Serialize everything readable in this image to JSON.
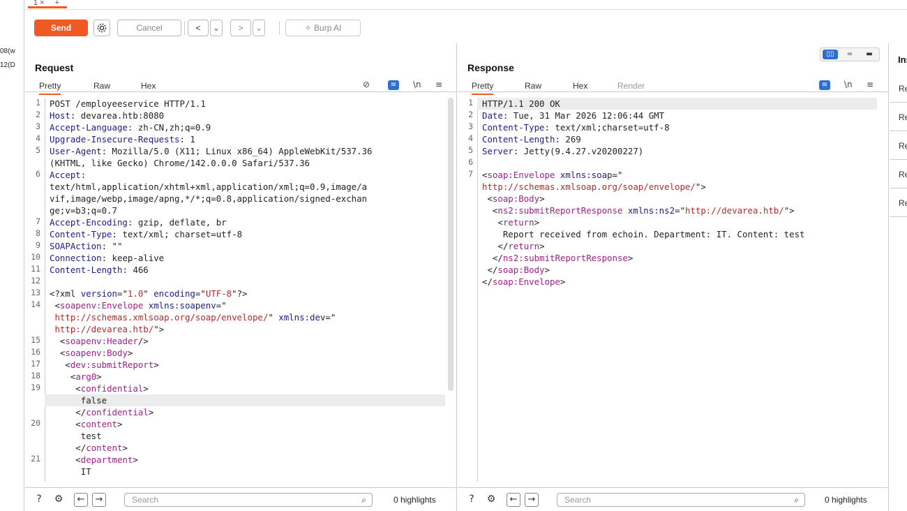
{
  "left_gutter": {
    "lines": [
      "08(w",
      "12(D"
    ]
  },
  "top_tab": {
    "label": "1 ×",
    "extra": "+"
  },
  "toolbar": {
    "send_label": "Send",
    "settings_icon": "gear-icon",
    "cancel_label": "Cancel",
    "back_label": "<",
    "back_menu_label": "⌄",
    "forward_label": ">",
    "forward_menu_label": "⌄",
    "burp_ai_label": "✧ Burp AI"
  },
  "request": {
    "title": "Request",
    "tabs": [
      "Pretty",
      "Raw",
      "Hex"
    ],
    "icons": {
      "hide": "⊘",
      "wrap": "≡",
      "newline": "\\n",
      "menu": "≡"
    },
    "lines": [
      {
        "n": "1",
        "html": "POST /employeeservice HTTP/1.1"
      },
      {
        "n": "2",
        "html": "<span class=\"k\">Host</span>: devarea.htb:8080"
      },
      {
        "n": "3",
        "html": "<span class=\"k\">Accept-Language</span>: zh-CN,zh;q=0.9"
      },
      {
        "n": "4",
        "html": "<span class=\"k\">Upgrade-Insecure-Requests</span>: 1"
      },
      {
        "n": "5",
        "html": "<span class=\"k\">User-Agent</span>: Mozilla/5.0 (X11; Linux x86_64) AppleWebKit/537.36"
      },
      {
        "n": "",
        "html": "(KHTML, like Gecko) Chrome/142.0.0.0 Safari/537.36"
      },
      {
        "n": "6",
        "html": "<span class=\"k\">Accept</span>:"
      },
      {
        "n": "",
        "html": "text/html,application/xhtml+xml,application/xml;q=0.9,image/a"
      },
      {
        "n": "",
        "html": "vif,image/webp,image/apng,*/*;q=0.8,application/signed-exchan"
      },
      {
        "n": "",
        "html": "ge;v=b3;q=0.7"
      },
      {
        "n": "7",
        "html": "<span class=\"k\">Accept-Encoding</span>: gzip, deflate, br"
      },
      {
        "n": "8",
        "html": "<span class=\"k\">Content-Type</span>: text/xml; charset=utf-8"
      },
      {
        "n": "9",
        "html": "<span class=\"k\">SOAPAction</span>: \"\""
      },
      {
        "n": "10",
        "html": "<span class=\"k\">Connection</span>: keep-alive"
      },
      {
        "n": "11",
        "html": "<span class=\"k\">Content-Length</span>: 466"
      },
      {
        "n": "12",
        "html": ""
      },
      {
        "n": "13",
        "html": "&lt;?xml <span class=\"k\">version</span>=\"<span class=\"s\">1.0</span>\" <span class=\"k\">encoding</span>=\"<span class=\"s\">UTF-8</span>\"?&gt;"
      },
      {
        "n": "14",
        "html": " &lt;<span class=\"t\">soapenv:Envelope</span> <span class=\"k\">xmlns:soapenv</span>=\""
      },
      {
        "n": "",
        "html": " <span class=\"s\">http://schemas.xmlsoap.org/soap/envelope/</span>\" <span class=\"k\">xmlns:dev</span>=\""
      },
      {
        "n": "",
        "html": " <span class=\"s\">http://devarea.htb/</span>\"&gt;"
      },
      {
        "n": "15",
        "html": "  &lt;<span class=\"t\">soapenv:Header</span>/&gt;"
      },
      {
        "n": "16",
        "html": "  &lt;<span class=\"t\">soapenv:Body</span>&gt;"
      },
      {
        "n": "17",
        "html": "   &lt;<span class=\"t\">dev:submitReport</span>&gt;"
      },
      {
        "n": "18",
        "html": "    &lt;<span class=\"t\">arg0</span>&gt;"
      },
      {
        "n": "19",
        "html": "     &lt;<span class=\"t\">confidential</span>&gt;"
      },
      {
        "n": "",
        "html": "      false"
      },
      {
        "n": "",
        "html": "     &lt;/<span class=\"t\">confidential</span>&gt;"
      },
      {
        "n": "20",
        "html": "     &lt;<span class=\"t\">content</span>&gt;"
      },
      {
        "n": "",
        "html": "      test"
      },
      {
        "n": "",
        "html": "     &lt;/<span class=\"t\">content</span>&gt;"
      },
      {
        "n": "21",
        "html": "     &lt;<span class=\"t\">department</span>&gt;"
      },
      {
        "n": "",
        "html": "      IT"
      }
    ],
    "search_placeholder": "Search",
    "highlights": "0 highlights"
  },
  "response": {
    "title": "Response",
    "tabs": [
      "Pretty",
      "Raw",
      "Hex",
      "Render"
    ],
    "icons": {
      "wrap": "≡",
      "newline": "\\n",
      "menu": "≡"
    },
    "lines": [
      {
        "n": "1",
        "html": "HTTP/1.1 200 OK"
      },
      {
        "n": "2",
        "html": "<span class=\"k\">Date</span>: Tue, 31 Mar 2026 12:06:44 GMT"
      },
      {
        "n": "3",
        "html": "<span class=\"k\">Content-Type</span>: text/xml;charset=utf-8"
      },
      {
        "n": "4",
        "html": "<span class=\"k\">Content-Length</span>: 269"
      },
      {
        "n": "5",
        "html": "<span class=\"k\">Server</span>: Jetty(9.4.27.v20200227)"
      },
      {
        "n": "6",
        "html": ""
      },
      {
        "n": "7",
        "html": "&lt;<span class=\"t\">soap:Envelope</span> <span class=\"k\">xmlns:soap</span>=\""
      },
      {
        "n": "",
        "html": "<span class=\"s\">http://schemas.xmlsoap.org/soap/envelope/</span>\"&gt;"
      },
      {
        "n": "",
        "html": " &lt;<span class=\"t\">soap:Body</span>&gt;"
      },
      {
        "n": "",
        "html": "  &lt;<span class=\"t\">ns2:submitReportResponse</span> <span class=\"k\">xmlns:ns2</span>=\"<span class=\"s\">http://devarea.htb/</span>\"&gt;"
      },
      {
        "n": "",
        "html": "   &lt;<span class=\"t\">return</span>&gt;"
      },
      {
        "n": "",
        "html": "    Report received from echoin. Department: IT. Content: test"
      },
      {
        "n": "",
        "html": "   &lt;/<span class=\"t\">return</span>&gt;"
      },
      {
        "n": "",
        "html": "  &lt;/<span class=\"t\">ns2:submitReportResponse</span>&gt;"
      },
      {
        "n": "",
        "html": " &lt;/<span class=\"t\">soap:Body</span>&gt;"
      },
      {
        "n": "",
        "html": "&lt;/<span class=\"t\">soap:Envelope</span>&gt;"
      }
    ],
    "search_placeholder": "Search",
    "highlights": "0 highlights"
  },
  "view_toggle": {
    "options": [
      "▯▯",
      "=",
      "▬"
    ],
    "active": 0
  },
  "inspector": {
    "title": "Inspector",
    "rows": [
      "Request attributes",
      "Request query parameters",
      "Request body parameters",
      "Request cookies",
      "Request headers"
    ]
  },
  "colors": {
    "accent": "#f05a22",
    "blue": "#2d6fd1",
    "tag": "#a0208a",
    "key": "#1c1c8c",
    "string": "#b52a2a"
  }
}
